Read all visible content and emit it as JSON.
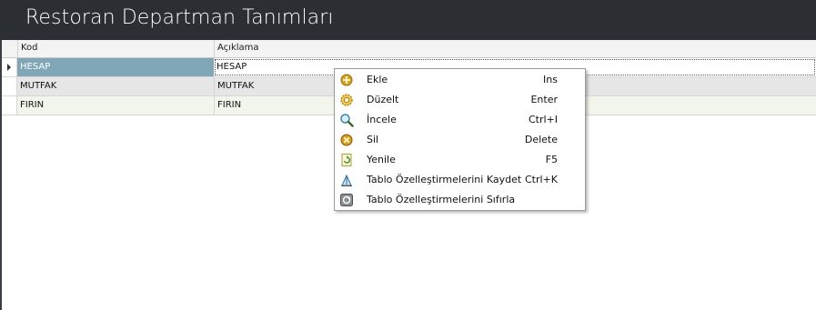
{
  "window": {
    "title": "Restoran Departman Tanımları"
  },
  "grid": {
    "columns": [
      "Kod",
      "Açıklama"
    ],
    "rows": [
      [
        "HESAP",
        "HESAP"
      ],
      [
        "MUTFAK",
        "MUTFAK"
      ],
      [
        "FIRIN",
        "FIRIN"
      ]
    ],
    "selected_row": 0
  },
  "context_menu": {
    "items": [
      {
        "label": "Ekle",
        "shortcut": "Ins",
        "icon": "add-icon"
      },
      {
        "label": "Düzelt",
        "shortcut": "Enter",
        "icon": "edit-gear-icon"
      },
      {
        "label": "İncele",
        "shortcut": "Ctrl+I",
        "icon": "magnifier-icon"
      },
      {
        "label": "Sil",
        "shortcut": "Delete",
        "icon": "delete-icon"
      },
      {
        "label": "Yenile",
        "shortcut": "F5",
        "icon": "refresh-icon"
      },
      {
        "label": "Tablo Özelleştirmelerini Kaydet",
        "shortcut": "Ctrl+K",
        "icon": "save-layout-icon"
      },
      {
        "label": "Tablo Özelleştirmelerini Sıfırla",
        "shortcut": "",
        "icon": "reset-layout-icon"
      }
    ]
  },
  "colors": {
    "title_bar": "#2b2e33",
    "selected_cell": "#7fa7b7",
    "row_alt": "#e6e6e6",
    "row_third": "#f2f5ec"
  }
}
